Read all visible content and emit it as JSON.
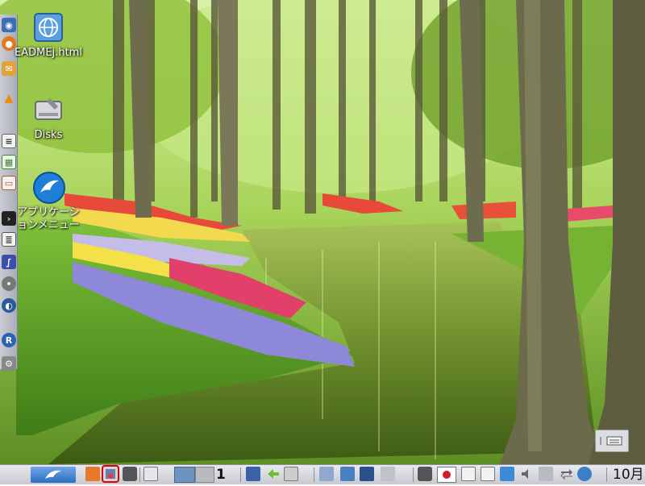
{
  "desktop": {
    "icons": [
      {
        "label": "EADMEj.html",
        "icon": "globe-html-icon"
      },
      {
        "label": "Disks",
        "icon": "disk-drive-icon"
      },
      {
        "label_line1": "アプリケーシ",
        "label_line2": "ョンメニュー",
        "icon": "lubuntu-bird-icon"
      }
    ]
  },
  "dock": {
    "items": [
      "browser",
      "firefox",
      "mail",
      "vlc",
      "document",
      "spreadsheet",
      "presentation",
      "terminal",
      "text-editor",
      "inkscape",
      "disc",
      "thunderbird",
      "r-language",
      "settings"
    ]
  },
  "taskbar": {
    "workspace_number": "1",
    "clock": "10月",
    "colors": {
      "panel": "#d7d9de",
      "selected_outline": "#e00000"
    }
  }
}
